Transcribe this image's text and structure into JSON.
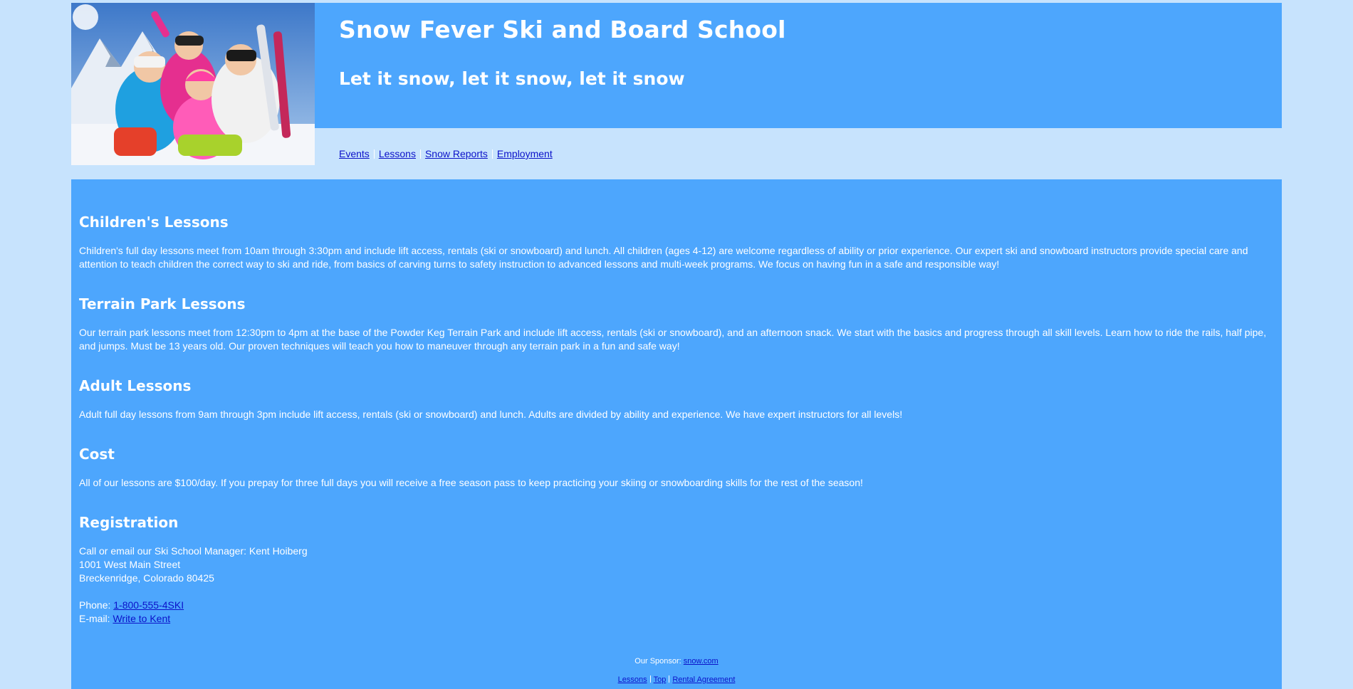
{
  "header": {
    "title": "Snow Fever Ski and Board School",
    "tagline": "Let it snow, let it snow, let it snow"
  },
  "nav": {
    "items": [
      "Events",
      "Lessons",
      "Snow Reports",
      "Employment"
    ]
  },
  "sections": {
    "children": {
      "heading": "Children's Lessons",
      "body": "Children's full day lessons meet from 10am through 3:30pm and include lift access, rentals (ski or snowboard) and lunch. All children (ages 4-12) are welcome regardless of ability or prior experience. Our expert ski and snowboard instructors provide special care and attention to teach children the correct way to ski and ride, from basics of carving turns to safety instruction to advanced lessons and multi-week programs. We focus on having fun in a safe and responsible way!"
    },
    "terrain": {
      "heading": "Terrain Park Lessons",
      "body": "Our terrain park lessons meet from 12:30pm to 4pm at the base of the Powder Keg Terrain Park and include lift access, rentals (ski or snowboard), and an afternoon snack. We start with the basics and progress through all skill levels. Learn how to ride the rails, half pipe, and jumps. Must be 13 years old. Our proven techniques will teach you how to maneuver through any terrain park in a fun and safe way!"
    },
    "adult": {
      "heading": "Adult Lessons",
      "body": "Adult full day lessons from 9am through 3pm include lift access, rentals (ski or snowboard) and lunch. Adults are divided by ability and experience. We have expert instructors for all levels!"
    },
    "cost": {
      "heading": "Cost",
      "body": "All of our lessons are $100/day. If you prepay for three full days you will receive a free season pass to keep practicing your skiing or snowboarding skills for the rest of the season!"
    },
    "registration": {
      "heading": "Registration",
      "line1": "Call or email our Ski School Manager: Kent Hoiberg",
      "line2": "1001 West Main Street",
      "line3": "Breckenridge, Colorado 80425",
      "phone_label": "Phone: ",
      "phone": "1-800-555-4SKI",
      "email_label": "E-mail: ",
      "email_link": "Write to Kent"
    }
  },
  "footer": {
    "sponsor_label": "Our Sponsor: ",
    "sponsor_link": "snow.com",
    "links": [
      "Lessons",
      "Top",
      "Rental Agreement"
    ]
  },
  "colors": {
    "page_background": "#c7e3fd",
    "panel_blue": "#4da6fd",
    "link": "#0b12c9",
    "text": "#ffffff"
  }
}
